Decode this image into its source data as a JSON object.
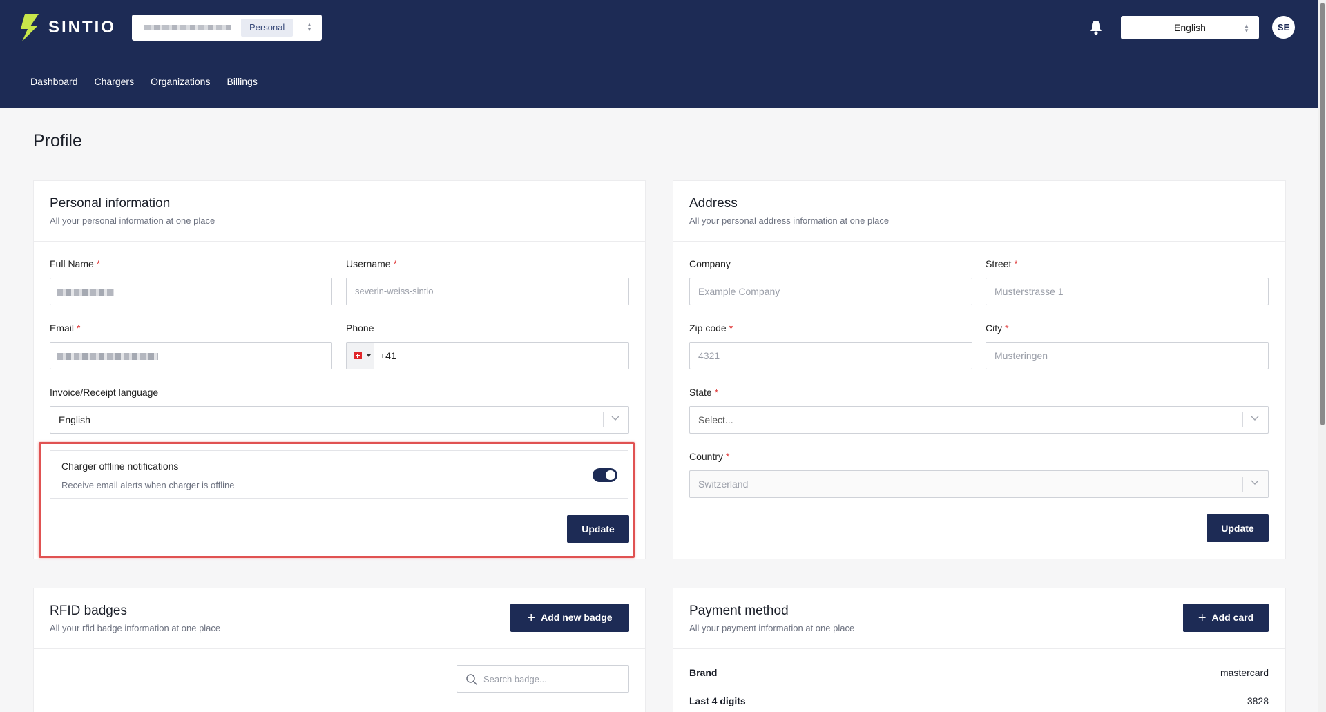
{
  "header": {
    "logo_text": "SINTIO",
    "org_chip": "Personal",
    "language": "English",
    "avatar_initials": "SE"
  },
  "nav": [
    "Dashboard",
    "Chargers",
    "Organizations",
    "Billings"
  ],
  "page_title": "Profile",
  "personal": {
    "title": "Personal information",
    "subtitle": "All your personal information at one place",
    "full_name_label": "Full Name",
    "username_label": "Username",
    "username_value": "severin-weiss-sintio",
    "email_label": "Email",
    "phone_label": "Phone",
    "phone_value": "+41",
    "invoice_lang_label": "Invoice/Receipt language",
    "invoice_lang_value": "English",
    "notif_title": "Charger offline notifications",
    "notif_sub": "Receive email alerts when charger is offline",
    "notif_enabled": true,
    "update_label": "Update"
  },
  "address": {
    "title": "Address",
    "subtitle": "All your personal address information at one place",
    "company_label": "Company",
    "company_placeholder": "Example Company",
    "street_label": "Street",
    "street_placeholder": "Musterstrasse 1",
    "zip_label": "Zip code",
    "zip_placeholder": "4321",
    "city_label": "City",
    "city_placeholder": "Musteringen",
    "state_label": "State",
    "state_value": "Select...",
    "country_label": "Country",
    "country_value": "Switzerland",
    "update_label": "Update"
  },
  "rfid": {
    "title": "RFID badges",
    "subtitle": "All your rfid badge information at one place",
    "add_label": "Add new badge",
    "search_placeholder": "Search badge..."
  },
  "payment": {
    "title": "Payment method",
    "subtitle": "All your payment information at one place",
    "add_label": "Add card",
    "brand_label": "Brand",
    "brand_value": "mastercard",
    "last4_label": "Last 4 digits",
    "last4_value": "3828"
  },
  "colors": {
    "brand": "#1d2b55",
    "required": "#e03c3c",
    "highlight": "#e05252"
  }
}
